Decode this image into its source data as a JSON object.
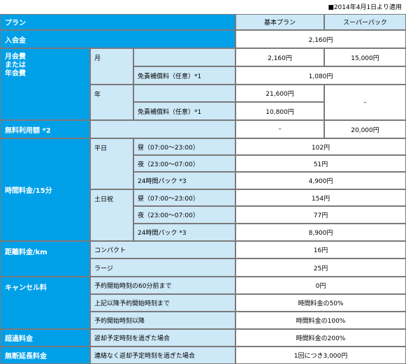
{
  "note": "■2014年4月1日より適用",
  "plans": {
    "header": "プラン",
    "basic": "基本プラン",
    "super": "スーパーパック"
  },
  "entry": {
    "label": "入会金",
    "fee": "2,160円"
  },
  "monthly": {
    "label": "月会費\nまたは\n年会費",
    "month": "月",
    "month_basic": "2,160円",
    "month_super": "15,000円",
    "insurance_label": "免責補償料（任意）*1",
    "month_insurance": "1,080円",
    "year": "年",
    "year_basic": "21,600円",
    "year_super": "–",
    "year_insurance": "10,800円"
  },
  "free": {
    "label": "無料利用額 *2",
    "basic": "–",
    "super": "20,000円"
  },
  "time": {
    "label": "時間料金/15分",
    "weekday": "平日",
    "holiday": "土日祝",
    "day_label": "昼（07:00〜23:00）",
    "night_label": "夜（23:00〜07:00）",
    "pack_label": "24時間パック *3",
    "weekday_day": "102円",
    "weekday_night": "51円",
    "weekday_pack": "4,900円",
    "holiday_day": "154円",
    "holiday_night": "77円",
    "holiday_pack": "8,900円"
  },
  "distance": {
    "label": "距離料金/km",
    "compact": "コンパクト",
    "compact_fee": "16円",
    "large": "ラージ",
    "large_fee": "25円"
  },
  "cancel": {
    "label": "キャンセル料",
    "r1": "予約開始時刻の60分前まで",
    "v1": "0円",
    "r2": "上記以降予約開始時刻まで",
    "v2": "時間料金の50%",
    "r3": "予約開始時刻以降",
    "v3": "時間料金の100%"
  },
  "overtime": {
    "label": "超過料金",
    "desc": "返却予定時刻を過ぎた場合",
    "fee": "時間料金の200%"
  },
  "nocontact": {
    "label": "無断延長料金",
    "desc": "連絡なく返却予定時刻を過ぎた場合",
    "fee": "1回につき3,000円"
  }
}
